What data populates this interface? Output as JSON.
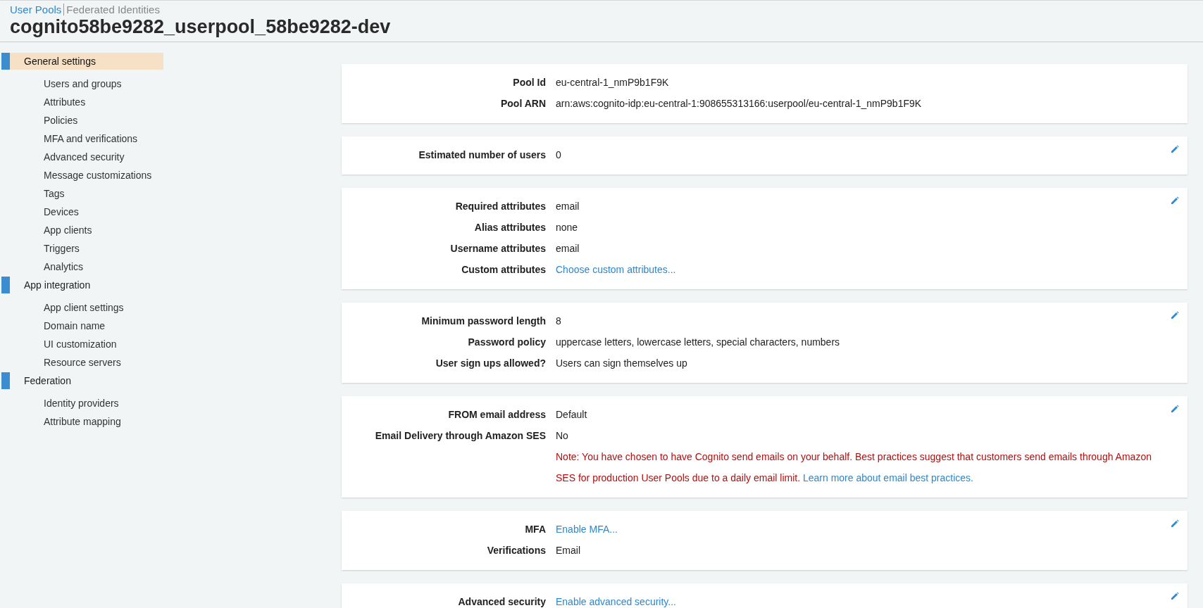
{
  "breadcrumb": [
    {
      "label": "User Pools",
      "selected": true
    },
    {
      "label": "Federated Identities",
      "selected": false
    }
  ],
  "title": "cognito58be9282_userpool_58be9282-dev",
  "sidebar": {
    "groups": [
      {
        "label": "General settings",
        "selected": true,
        "children": [
          {
            "label": "Users and groups",
            "selected": false
          },
          {
            "label": "Attributes",
            "selected": false
          },
          {
            "label": "Policies",
            "selected": false
          },
          {
            "label": "MFA and verifications",
            "selected": false
          },
          {
            "label": "Advanced security",
            "selected": false
          },
          {
            "label": "Message customizations",
            "selected": false
          },
          {
            "label": "Tags",
            "selected": false
          },
          {
            "label": "Devices",
            "selected": false
          },
          {
            "label": "App clients",
            "selected": false
          },
          {
            "label": "Triggers",
            "selected": false
          },
          {
            "label": "Analytics",
            "selected": false
          }
        ]
      },
      {
        "label": "App integration",
        "selected": false,
        "children": [
          {
            "label": "App client settings",
            "selected": false
          },
          {
            "label": "Domain name",
            "selected": false
          },
          {
            "label": "UI customization",
            "selected": false
          },
          {
            "label": "Resource servers",
            "selected": false
          }
        ]
      },
      {
        "label": "Federation",
        "selected": false,
        "children": [
          {
            "label": "Identity providers",
            "selected": false
          },
          {
            "label": "Attribute mapping",
            "selected": false
          }
        ]
      }
    ]
  },
  "cards": [
    {
      "editable": false,
      "rows": [
        {
          "kind": "text",
          "label": "Pool Id",
          "value": "eu-central-1_nmP9b1F9K"
        },
        {
          "kind": "text",
          "label": "Pool ARN",
          "value": "arn:aws:cognito-idp:eu-central-1:908655313166:userpool/eu-central-1_nmP9b1F9K"
        }
      ]
    },
    {
      "editable": true,
      "rows": [
        {
          "kind": "text",
          "label": "Estimated number of users",
          "value": "0"
        }
      ]
    },
    {
      "editable": true,
      "rows": [
        {
          "kind": "text",
          "label": "Required attributes",
          "value": "email"
        },
        {
          "kind": "text",
          "label": "Alias attributes",
          "value": "none"
        },
        {
          "kind": "text",
          "label": "Username attributes",
          "value": "email"
        },
        {
          "kind": "link",
          "label": "Custom attributes",
          "value": "Choose custom attributes..."
        }
      ]
    },
    {
      "editable": true,
      "rows": [
        {
          "kind": "text",
          "label": "Minimum password length",
          "value": "8"
        },
        {
          "kind": "text",
          "label": "Password policy",
          "value": "uppercase letters, lowercase letters, special characters, numbers"
        },
        {
          "kind": "text",
          "label": "User sign ups allowed?",
          "value": "Users can sign themselves up"
        }
      ]
    },
    {
      "editable": true,
      "rows": [
        {
          "kind": "text",
          "label": "FROM email address",
          "value": "Default"
        },
        {
          "kind": "text",
          "label": "Email Delivery through Amazon SES",
          "value": "No"
        },
        {
          "kind": "note",
          "value": "Note: You have chosen to have Cognito send emails on your behalf. Best practices suggest that customers send emails through Amazon SES for production User Pools due to a daily email limit.",
          "link": "Learn more about email best practices."
        }
      ]
    },
    {
      "editable": true,
      "rows": [
        {
          "kind": "link",
          "label": "MFA",
          "value": "Enable MFA..."
        },
        {
          "kind": "text",
          "label": "Verifications",
          "value": "Email"
        }
      ]
    },
    {
      "editable": true,
      "rows": [
        {
          "kind": "link",
          "label": "Advanced security",
          "value": "Enable advanced security..."
        }
      ]
    }
  ]
}
